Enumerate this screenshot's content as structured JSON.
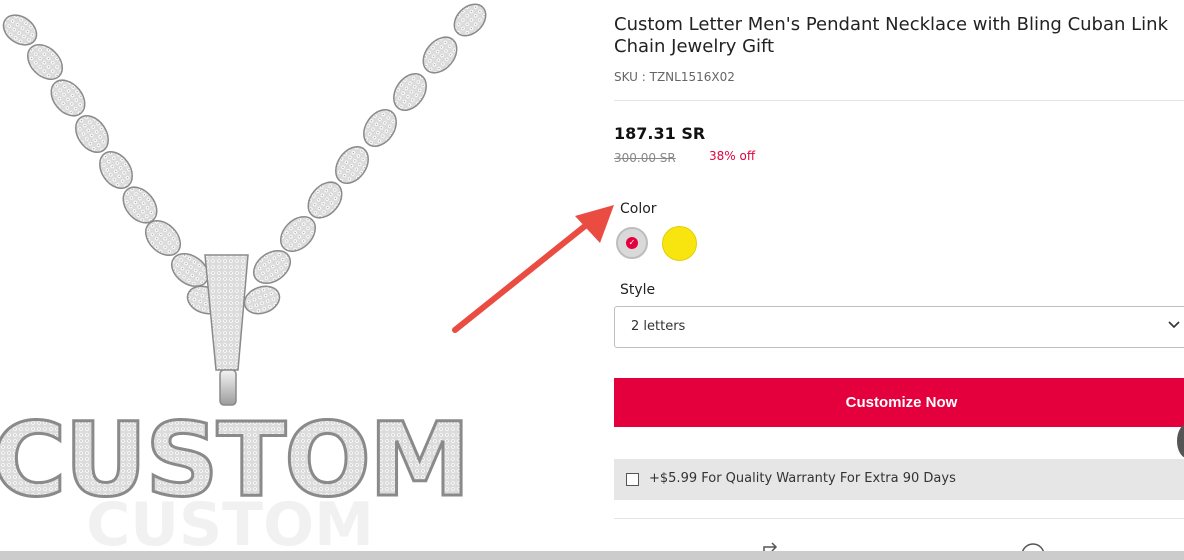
{
  "product": {
    "title": "Custom Letter Men's Pendant Necklace with Bling Cuban Link Chain Jewelry Gift",
    "sku": "SKU : TZNL1516X02",
    "price": "187.31 SR",
    "old_price": "300.00 SR",
    "discount": "38% off"
  },
  "image": {
    "pendant_text": "CUSTOM"
  },
  "options": {
    "color_label": "Color",
    "colors": [
      {
        "name": "silver",
        "hex": "#d9d9d9",
        "selected": true
      },
      {
        "name": "gold",
        "hex": "#f8e510",
        "selected": false
      }
    ],
    "style_label": "Style",
    "style_value": "2 letters"
  },
  "actions": {
    "customize_label": "Customize Now",
    "warranty_label": "+$5.99 For Quality Warranty For Extra 90 Days"
  },
  "colors": {
    "accent": "#e4003d",
    "arrow": "#ea4c42"
  },
  "icons": [
    "check-icon",
    "chevron-down-icon",
    "share-icon",
    "wishlist-icon"
  ]
}
